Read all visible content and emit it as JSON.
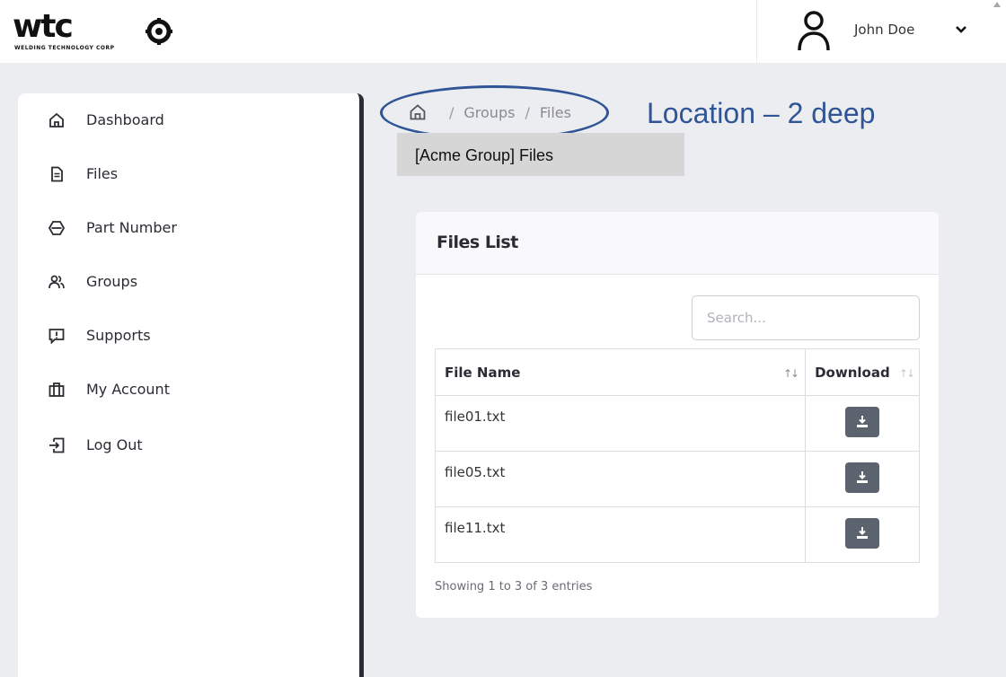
{
  "logo": {
    "word": "wtc",
    "subtitle": "WELDING TECHNOLOGY CORP"
  },
  "user": {
    "name": "John Doe"
  },
  "sidebar": {
    "items": [
      {
        "label": "Dashboard",
        "icon": "home-icon"
      },
      {
        "label": "Files",
        "icon": "document-icon"
      },
      {
        "label": "Part Number",
        "icon": "part-icon"
      },
      {
        "label": "Groups",
        "icon": "users-icon"
      },
      {
        "label": "Supports",
        "icon": "support-message-icon"
      },
      {
        "label": "My Account",
        "icon": "briefcase-icon"
      },
      {
        "label": "Log Out",
        "icon": "logout-icon"
      }
    ]
  },
  "breadcrumb": {
    "items": [
      "Groups",
      "Files"
    ],
    "separator": "/"
  },
  "annotation": {
    "text": "Location – 2 deep",
    "color": "#2f5597"
  },
  "group_tab": {
    "label": "[Acme Group] Files"
  },
  "card": {
    "title": "Files List",
    "search_placeholder": "Search...",
    "columns": [
      "File Name",
      "Download"
    ],
    "rows": [
      {
        "file": "file01.txt"
      },
      {
        "file": "file05.txt"
      },
      {
        "file": "file11.txt"
      }
    ],
    "info": "Showing 1 to 3 of 3 entries"
  },
  "colors": {
    "sidebar_border": "#2b2b33",
    "download_button": "#5b636e",
    "background": "#ecedf1"
  }
}
